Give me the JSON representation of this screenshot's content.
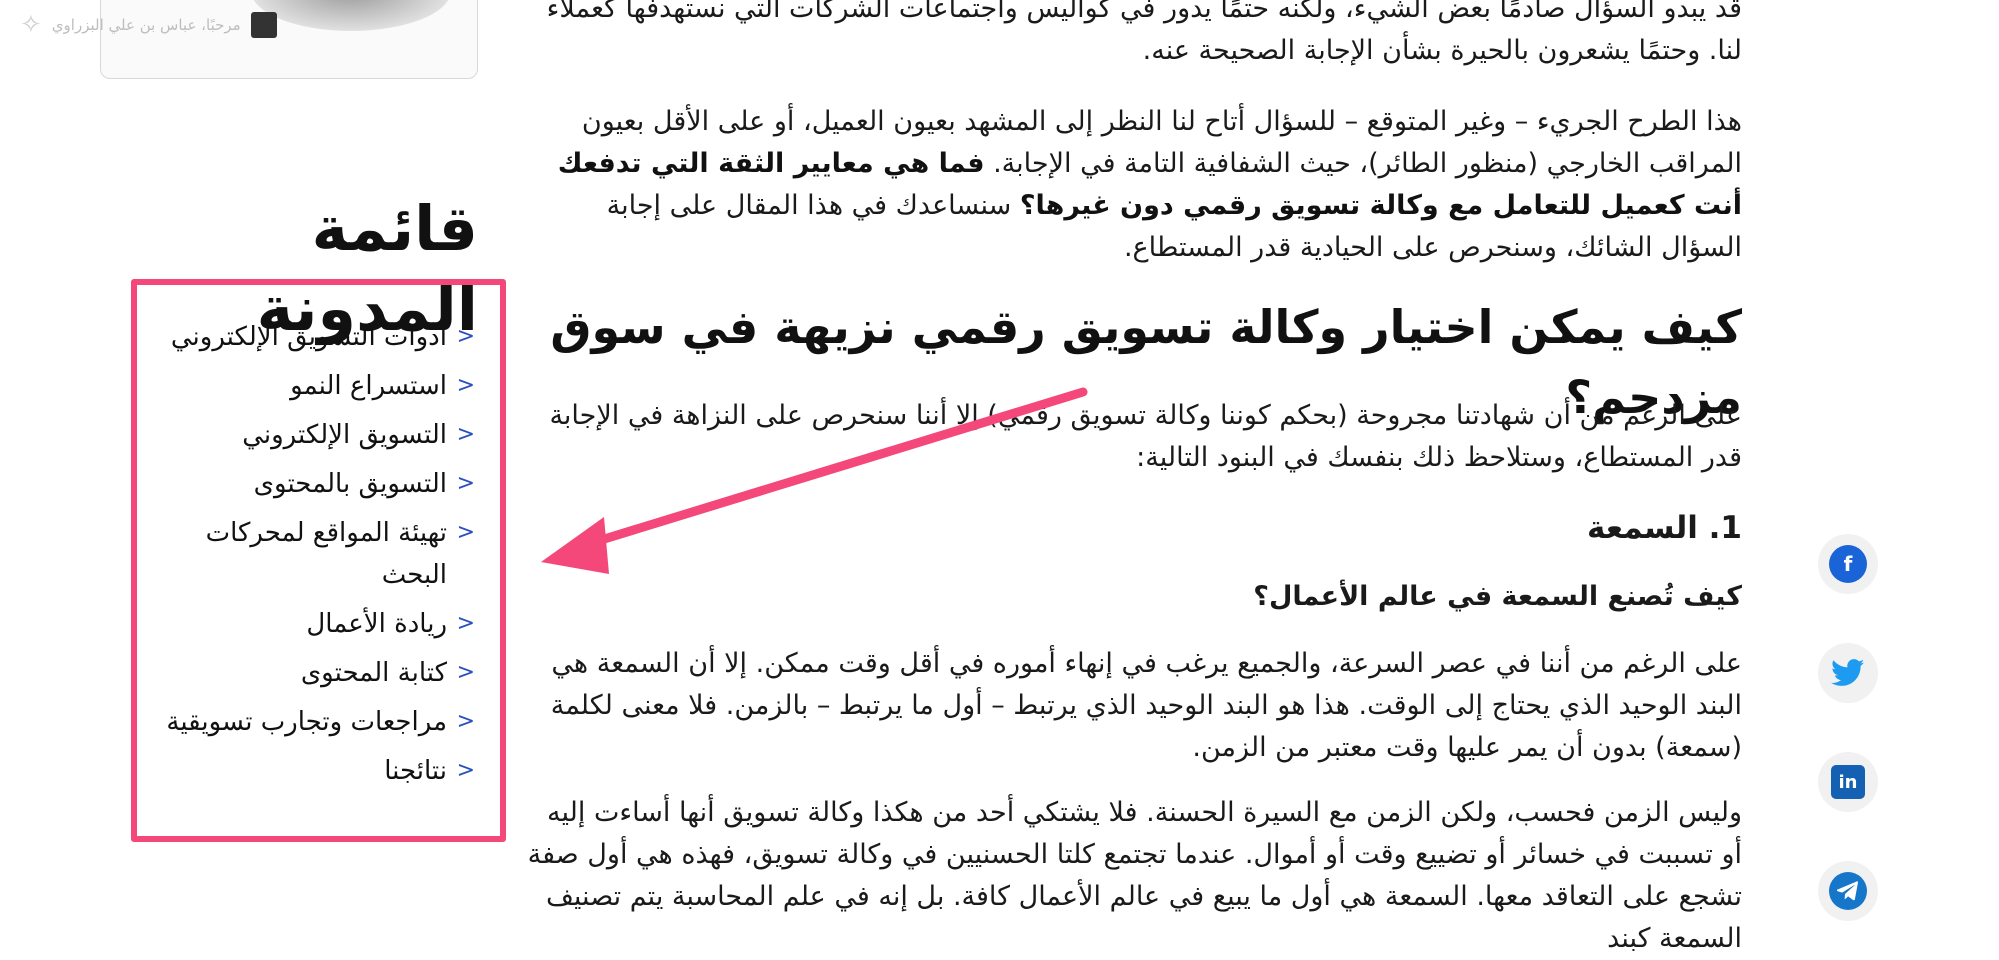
{
  "user": {
    "greeting": "مرحبًا، عباس بن علي البزراوي"
  },
  "article": {
    "intro_tail": "قد يبدو السؤال صادمًا بعض الشيء، ولكنه حتمًا يدور في كواليس واجتماعات الشركات التي نستهدفها كعملاء لنا. وحتمًا يشعرون بالحيرة بشأن الإجابة الصحيحة عنه.",
    "transparency_p1": "هذا الطرح الجريء – وغير المتوقع – للسؤال أتاح لنا النظر إلى المشهد بعيون العميل، أو على الأقل بعيون المراقب الخارجي (منظور الطائر)، حيث الشفافية التامة في الإجابة. ",
    "transparency_bold": "فما هي معايير الثقة التي تدفعك أنت كعميل للتعامل مع وكالة تسويق رقمي دون غيرها؟",
    "transparency_p2": " سنساعدك في هذا المقال على إجابة السؤال الشائك، وسنحرص على الحيادية قدر المستطاع.",
    "h2_choose": "كيف يمكن اختيار  وكالة تسويق رقمي نزيهة في سوق مزدحم؟",
    "bias_p": "على الرغم من أن شهادتنا مجروحة (بحكم كوننا وكالة تسويق رقمي) إلا أننا سنحرص على النزاهة في الإجابة قدر المستطاع، وستلاحظ ذلك بنفسك في البنود التالية:",
    "h3_reputation": "1. السمعة",
    "h4_how": "كيف تُصنع السمعة في عالم الأعمال؟",
    "time_p": "على الرغم من أننا في عصر السرعة، والجميع يرغب في إنهاء أموره في أقل وقت ممكن. إلا أن السمعة هي البند الوحيد الذي يحتاج إلى الوقت. هذا هو البند الوحيد الذي يرتبط – أول ما يرتبط – بالزمن. فلا معنى لكلمة (سمعة) بدون أن يمر عليها وقت معتبر من الزمن.",
    "notonly_p": "وليس الزمن فحسب، ولكن الزمن مع السيرة الحسنة. فلا يشتكي أحد من هكذا وكالة تسويق أنها أساءت إليه أو تسببت في خسائر أو تضييع وقت أو أموال. عندما تجتمع كلتا الحسنيين في وكالة تسويق، فهذه هي أول صفة تشجع على التعاقد معها. السمعة هي أول ما يبيع في عالم الأعمال كافة. بل إنه في علم المحاسبة يتم تصنيف السمعة كبند"
  },
  "sidebar": {
    "title": "قائمة المدونة",
    "items": [
      {
        "label": "أدوات التسويق الإلكتروني"
      },
      {
        "label": "استسراع النمو"
      },
      {
        "label": "التسويق الإلكتروني"
      },
      {
        "label": "التسويق بالمحتوى"
      },
      {
        "label": "تهيئة المواقع لمحركات البحث"
      },
      {
        "label": "ريادة الأعمال"
      },
      {
        "label": "كتابة المحتوى"
      },
      {
        "label": "مراجعات وتجارب تسويقية"
      },
      {
        "label": "نتائجنا"
      }
    ],
    "chevron": "<"
  },
  "share": {
    "facebook": "f",
    "twitter": "twitter-icon",
    "linkedin": "in",
    "telegram": "telegram-icon"
  },
  "colors": {
    "highlight_box": "#f4477a",
    "arrow": "#f4477a",
    "chevron": "#2a4fbf",
    "facebook": "#1a64d8",
    "twitter": "#1d9bf0",
    "linkedin": "#1461b3",
    "telegram": "#1676c9"
  }
}
